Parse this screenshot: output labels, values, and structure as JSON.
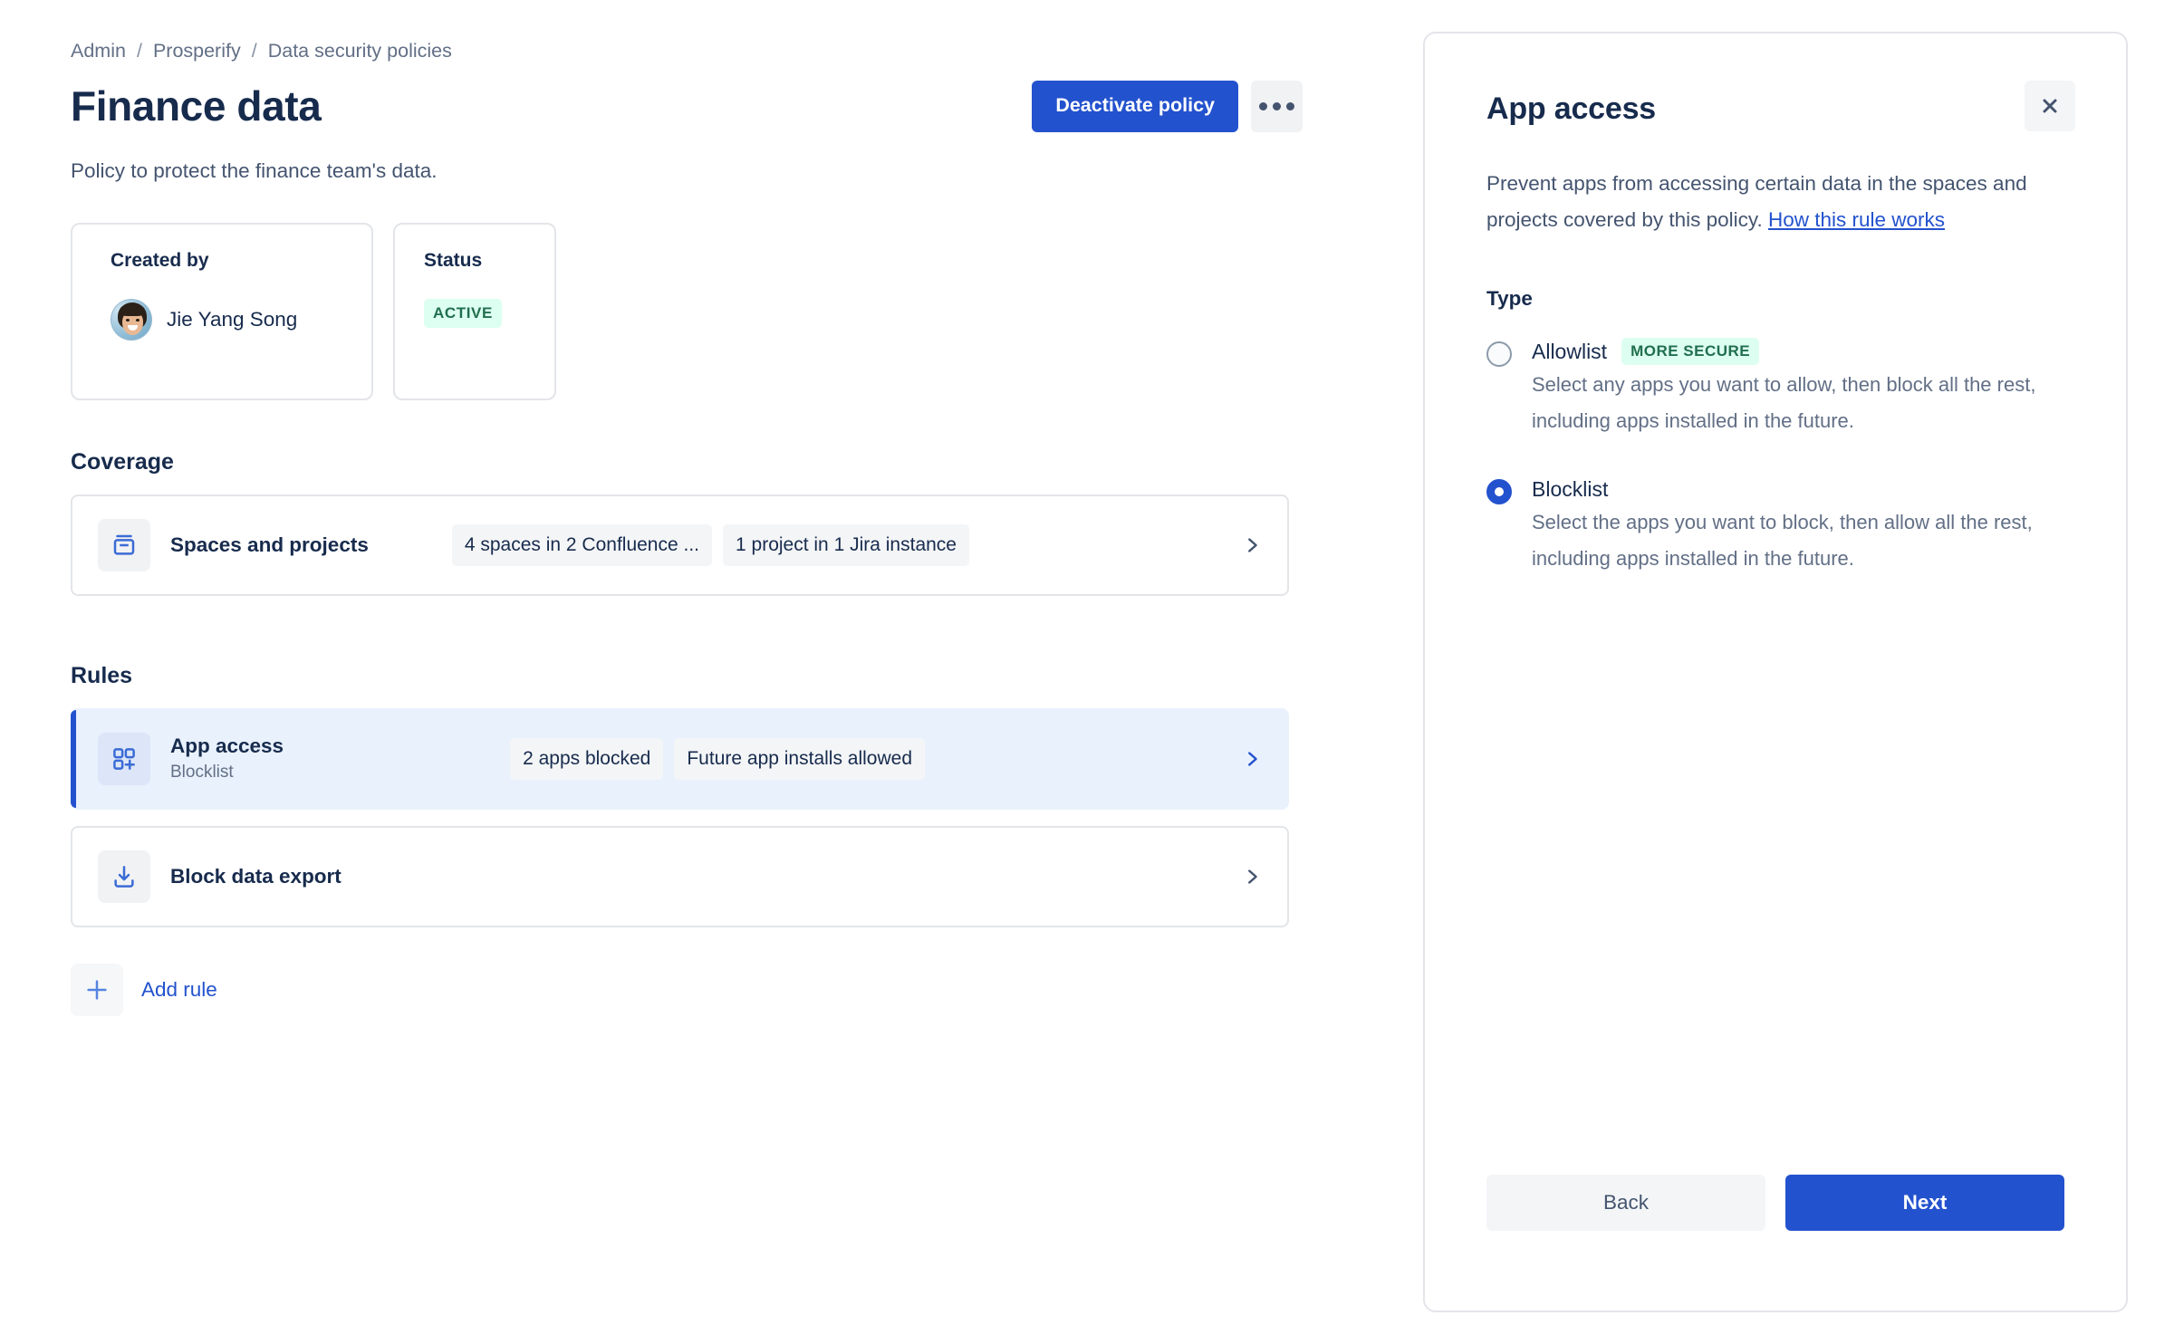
{
  "breadcrumb": {
    "items": [
      {
        "label": "Admin"
      },
      {
        "label": "Prosperify"
      },
      {
        "label": "Data security policies"
      }
    ],
    "separator": "/"
  },
  "header": {
    "title": "Finance data",
    "description": "Policy to protect the finance team's data.",
    "deactivate_label": "Deactivate policy",
    "more_actions_label": "More actions"
  },
  "meta": {
    "created_by": {
      "label": "Created by",
      "name": "Jie Yang Song"
    },
    "status": {
      "label": "Status",
      "value": "ACTIVE"
    }
  },
  "coverage": {
    "section_title": "Coverage",
    "row": {
      "title": "Spaces and projects",
      "icon": "spaces-projects-icon",
      "lozenges": [
        "4 spaces in 2 Confluence ...",
        "1 project in 1 Jira instance"
      ]
    }
  },
  "rules": {
    "section_title": "Rules",
    "items": [
      {
        "title": "App access",
        "subtitle": "Blocklist",
        "icon": "app-access-icon",
        "lozenges": [
          "2 apps blocked",
          "Future app installs allowed"
        ],
        "selected": true
      },
      {
        "title": "Block data export",
        "subtitle": "",
        "icon": "data-export-icon",
        "lozenges": [],
        "selected": false
      }
    ],
    "add_rule_label": "Add rule"
  },
  "panel": {
    "title": "App access",
    "close_label": "Close",
    "description_before_link": "Prevent apps from accessing certain data in the spaces and projects covered by this policy. ",
    "description_link": "How this rule works",
    "type_label": "Type",
    "options": [
      {
        "id": "allowlist",
        "label": "Allowlist",
        "badge": "MORE SECURE",
        "description": "Select any apps you want to allow, then block all the rest, including apps installed in the future.",
        "selected": false
      },
      {
        "id": "blocklist",
        "label": "Blocklist",
        "badge": "",
        "description": "Select the apps you want to block, then allow all the rest, including apps installed in the future.",
        "selected": true
      }
    ],
    "back_label": "Back",
    "next_label": "Next"
  },
  "colors": {
    "brand_blue": "#2352CE",
    "selected_row_bg": "#E9F1FD",
    "text_primary": "#172B4D",
    "text_subtle": "#626F86",
    "success_bg": "#DCFFF1",
    "success_text": "#216E4E",
    "border": "#E3E5E9"
  }
}
